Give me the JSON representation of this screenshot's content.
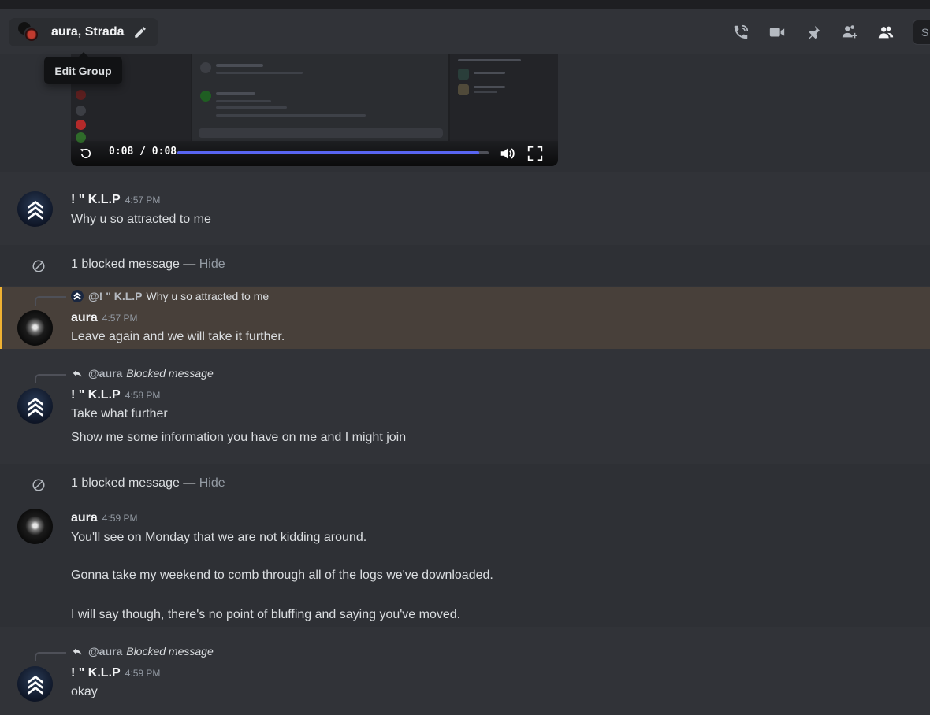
{
  "header": {
    "group_name": "aura, Strada",
    "tooltip": "Edit Group",
    "icons": [
      "phone-call-icon",
      "video-camera-icon",
      "pin-icon",
      "add-member-icon",
      "member-list-icon",
      "search-icon"
    ],
    "search_placeholder": "S"
  },
  "video": {
    "time": "0:08 / 0:08",
    "progress": 0.97,
    "accent_color": "#5865f2"
  },
  "messages": [
    {
      "author": "! \" K.L.P",
      "time": "4:57 PM",
      "lines": [
        "Why u so attracted to me"
      ]
    },
    {
      "author": "aura",
      "time": "4:57 PM",
      "reply_to_author": "@! \" K.L.P",
      "reply_to_text": "Why u so attracted to me",
      "lines": [
        "Leave again and we will take it further."
      ]
    },
    {
      "author": "! \" K.L.P",
      "time": "4:58 PM",
      "reply_to_author": "@aura",
      "reply_to_text": "Blocked message",
      "lines": [
        "Take what further",
        "Show me some information you have on me and I might join"
      ]
    },
    {
      "author": "aura",
      "time": "4:59 PM",
      "lines": [
        "You'll see on Monday that we are not kidding around.",
        "Gonna take my weekend to comb through all of the logs we've downloaded.",
        "I will say though, there's no point of bluffing and saying you've moved."
      ]
    },
    {
      "author": "! \" K.L.P",
      "time": "4:59 PM",
      "reply_to_author": "@aura",
      "reply_to_text": "Blocked message",
      "lines": [
        "okay"
      ]
    }
  ],
  "blocked": {
    "label": "1 blocked message — ",
    "action": "Hide"
  },
  "colors": {
    "mention_highlight": "#48403a",
    "mention_bar": "#f0b232"
  }
}
